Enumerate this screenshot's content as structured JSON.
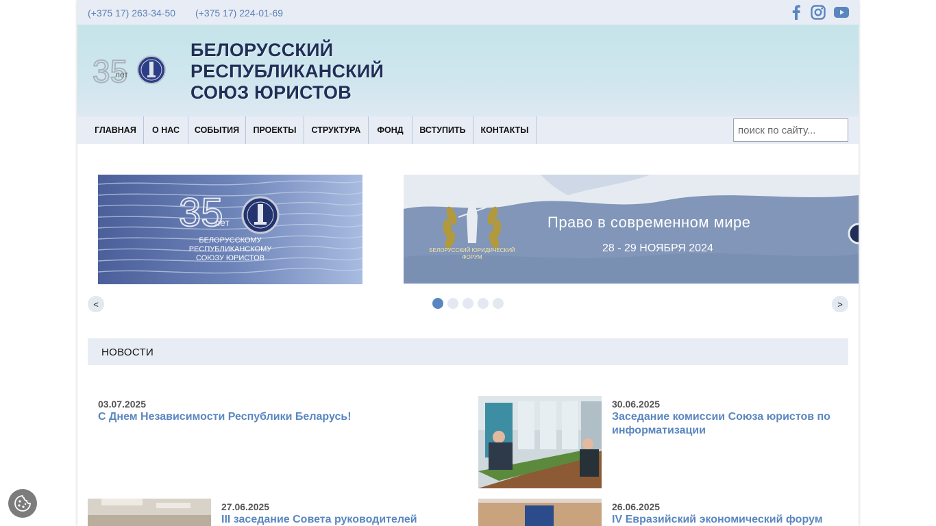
{
  "topbar": {
    "phone1": "(+375 17) 263-34-50",
    "phone2": "(+375 17) 224-01-69",
    "social": [
      "facebook-icon",
      "instagram-icon",
      "youtube-icon"
    ]
  },
  "header": {
    "logo_label": "лет",
    "title_line1": "БЕЛОРУССКИЙ",
    "title_line2": "РЕСПУБЛИКАНСКИЙ",
    "title_line3": "СОЮЗ ЮРИСТОВ"
  },
  "nav": {
    "items": [
      "ГЛАВНАЯ",
      "О НАС",
      "СОБЫТИЯ",
      "ПРОЕКТЫ",
      "СТРУКТУРА",
      "ФОНД",
      "ВСТУПИТЬ",
      "КОНТАКТЫ"
    ],
    "search_placeholder": "поиск по сайту..."
  },
  "slider": {
    "slide1": {
      "number": "35",
      "label": "лет",
      "line1": "БЕЛОРУССКОМУ",
      "line2": "РЕСПУБЛИКАНСКОМУ",
      "line3": "СОЮЗУ ЮРИСТОВ"
    },
    "slide2": {
      "title": "Право в современном мире",
      "dates": "28 - 29 НОЯБРЯ 2024",
      "forum_line1": "БЕЛОРУССКИЙ ЮРИДИЧЕСКИЙ",
      "forum_line2": "ФОРУМ"
    },
    "prev_label": "<",
    "next_label": ">",
    "dots_count": 5,
    "active_dot": 1
  },
  "news": {
    "header": "НОВОСТИ",
    "items": [
      {
        "date": "03.07.2025",
        "title": "С Днем Независимости Республики Беларусь!"
      },
      {
        "date": "30.06.2025",
        "title_line1": "Заседание комиссии Союза юристов по",
        "title_line2": "информатизации"
      },
      {
        "date": "27.06.2025",
        "title": "III заседание Совета руководителей"
      },
      {
        "date": "26.06.2025",
        "title": "IV Евразийский экономический форум"
      }
    ]
  },
  "colors": {
    "accent": "#5a86c0",
    "title": "#1f2f57",
    "bar": "#e8ecf4"
  }
}
